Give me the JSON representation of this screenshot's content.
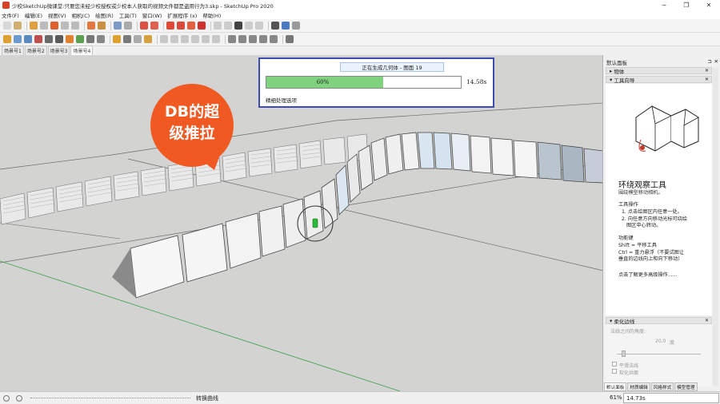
{
  "window": {
    "title": "少校SketchUp微课堂:只要您未经少校授权或少校本人获取的视频文件都是盗用行为3.skp - SketchUp Pro 2020",
    "minimize": "─",
    "maximize": "❐",
    "close": "✕"
  },
  "menu": {
    "file": "文件(F)",
    "edit": "编辑(E)",
    "view": "视图(V)",
    "camera": "相机(C)",
    "draw": "绘图(R)",
    "tools": "工具(T)",
    "window": "窗口(W)",
    "extensions": "扩展程序 (x)",
    "help": "帮助(H)"
  },
  "scenes": [
    "场景号1",
    "场景号2",
    "场景号3",
    "场景号4"
  ],
  "badge": {
    "line1": "DB的超",
    "line2": "级推拉"
  },
  "progress": {
    "header": "正在生成几何体 - 图面 19",
    "percent_label": "60%",
    "fraction": 0.6,
    "time": "14.58s",
    "subtext": "精细处理选项"
  },
  "panel": {
    "title": "默认面板",
    "pin": "⊐",
    "close": "✕",
    "entity_section": "物体",
    "instructor_section": "工具向导",
    "instructor": {
      "tool_title": "环绕观察工具",
      "tool_desc": "围绕模型移动相机。",
      "ops_title": "工具操作",
      "op1": "1. 点击绘图区内任意一处。",
      "op2a": "2. 向任意方向移动光标可绕绘",
      "op2b": "图区中心转动。",
      "keys_title": "功能键",
      "key1": "Shift = 平移工具",
      "key2a": "Ctrl = 重力悬浮（不要试图让",
      "key2b": "垂直的边线向上和向下移动）",
      "more": "点击了解更多高级操作......"
    },
    "soften_section": "柔化边线",
    "soften": {
      "angle_label": "法线之间的角度:",
      "angle_value": "20.0",
      "angle_unit": "度",
      "smooth_normals": "平滑法线",
      "soften_coplanar": "软化共面"
    },
    "tabs": [
      "默认面板",
      "材质编辑",
      "风格样式",
      "模型管理"
    ]
  },
  "status": {
    "hint": "转换曲线",
    "zoom": "61%",
    "measurements": "14.73s"
  },
  "colors": {
    "badge": "#f05a22",
    "progress_fill": "#7fd37f",
    "dialog_border": "#3b4bb0"
  }
}
